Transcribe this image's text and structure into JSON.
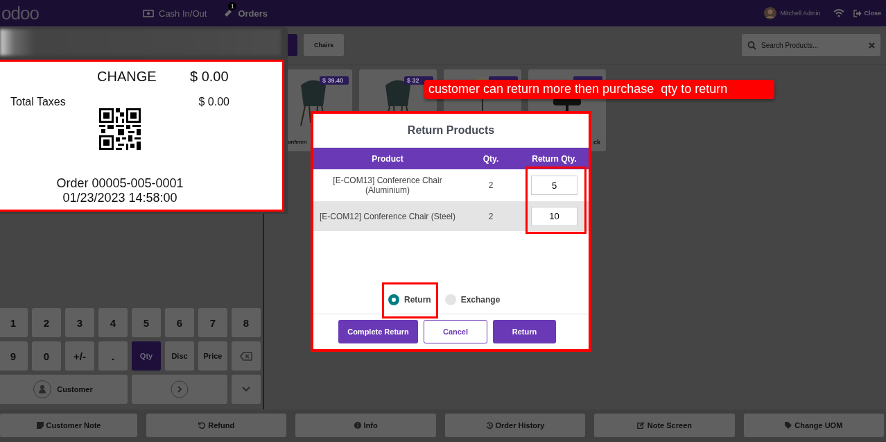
{
  "top_bar": {
    "logo": "odoo",
    "menu": [
      {
        "label": "Cash In/Out",
        "kind": "cash"
      },
      {
        "label": "Orders",
        "kind": "orders",
        "badge": "1"
      }
    ],
    "user": "Mitchell Admin",
    "close": "Close"
  },
  "toolbar": {
    "category": "Chairs",
    "search": {
      "placeholder": "Search Products..."
    }
  },
  "products": [
    {
      "kind": "picture",
      "price": "$ 39.40",
      "name": "onferen"
    },
    {
      "kind": "picture",
      "price": "$ 32"
    },
    {
      "kind": "picture"
    },
    {
      "kind": "picture",
      "name": "ck"
    }
  ],
  "receipt": {
    "change_label": "CHANGE",
    "change_value": "$ 0.00",
    "taxes_label": "Total Taxes",
    "taxes_value": "$ 0.00",
    "order": "Order 00005-005-0001",
    "date": "01/23/2023 14:58:00"
  },
  "numpad": {
    "keys": [
      {
        "label": "1",
        "selected": false
      },
      {
        "label": "2",
        "selected": false
      },
      {
        "label": "3",
        "selected": false
      },
      {
        "label": "4",
        "selected": false
      },
      {
        "label": "5",
        "selected": false
      },
      {
        "label": "6",
        "selected": false
      },
      {
        "label": "7",
        "selected": false
      },
      {
        "label": "8",
        "selected": false
      },
      {
        "label": "9",
        "selected": false
      },
      {
        "label": "0",
        "selected": false
      },
      {
        "label": "+/-",
        "selected": false
      },
      {
        "label": ".",
        "selected": false
      },
      {
        "label": "Qty",
        "selected": true
      },
      {
        "label": "Disc",
        "selected": false
      },
      {
        "label": "Price",
        "selected": false
      },
      {
        "kind": "backspace",
        "selected": false
      }
    ],
    "customer": "Customer"
  },
  "dialog": {
    "title": "Return Products",
    "columns": [
      "Product",
      "Qty.",
      "Return Qty."
    ],
    "rows": [
      {
        "product": "[E-COM13] Conference Chair (Aluminium)",
        "qty": "2",
        "return_qty": "5"
      },
      {
        "product": "[E-COM12] Conference Chair (Steel)",
        "qty": "2",
        "return_qty": "10"
      }
    ],
    "options": [
      {
        "label": "Return",
        "selected": true
      },
      {
        "label": "Exchange",
        "selected": false
      }
    ],
    "buttons": [
      {
        "label": "Complete Return",
        "kind": "primary"
      },
      {
        "label": "Cancel",
        "kind": "outline"
      },
      {
        "label": "Return",
        "kind": "primary"
      }
    ]
  },
  "annotation": "customer can return more then purchase  qty to return",
  "action_buttons": [
    {
      "label": "Customer Note",
      "kind": "note"
    },
    {
      "label": "Refund",
      "kind": "undo"
    },
    {
      "label": "Info",
      "kind": "info"
    },
    {
      "label": "Order History",
      "kind": "history"
    },
    {
      "label": "Note Screen",
      "kind": "edit"
    },
    {
      "label": "Change UOM",
      "kind": "tag"
    }
  ]
}
